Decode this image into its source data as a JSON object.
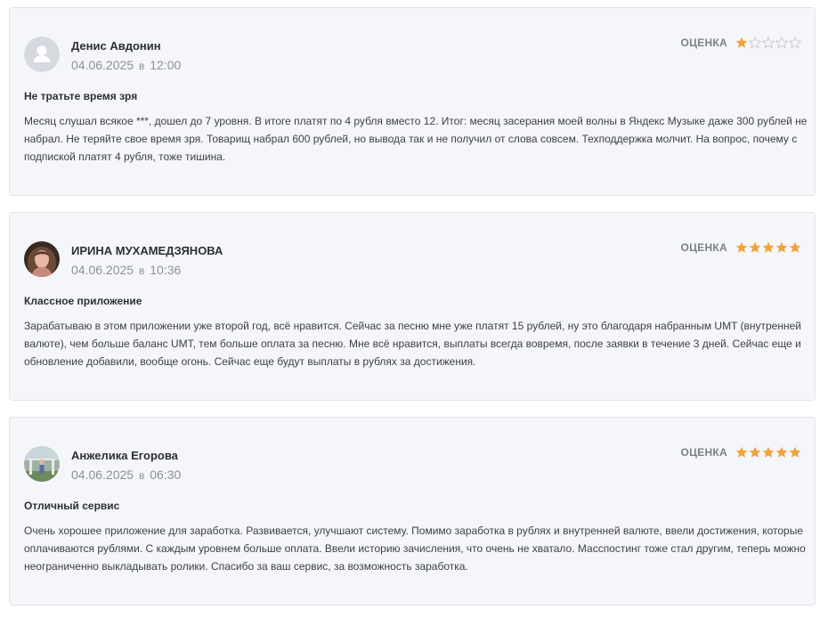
{
  "reviews": [
    {
      "author": "Денис Авдонин",
      "date": "04.06.2025",
      "at": "в",
      "time": "12:00",
      "rating_label": "ОЦЕНКА",
      "rating": 1,
      "rating_max": 5,
      "avatar": "default-user-avatar",
      "title": "Не тратьте время зря",
      "text": "Месяц слушал всякое ***, дошел до 7 уровня. В итоге платят по 4 рубля вместо 12. Итог: месяц засерания моей волны в Яндекс Музыке даже 300 рублей не набрал. Не теряйте свое время зря. Товарищ набрал 600 рублей, но вывода так и не получил от слова совсем. Техподдержка молчит. На вопрос, почему с подпиской платят 4 рубля, тоже тишина."
    },
    {
      "author": "ИРИНА МУХАМЕДЗЯНОВА",
      "date": "04.06.2025",
      "at": "в",
      "time": "10:36",
      "rating_label": "ОЦЕНКА",
      "rating": 5,
      "rating_max": 5,
      "avatar": "user-photo-avatar",
      "title": "Классное приложение",
      "text": "Зарабатываю в этом приложении уже второй год, всё нравится. Сейчас за песню мне уже платят 15 рублей, ну это благодаря набранным UMT (внутренней валюте), чем больше баланс UMT, тем больше оплата за песню. Мне всё нравится, выплаты всегда вовремя, после заявки в течение 3 дней. Сейчас еще и обновление добавили, вообще огонь. Сейчас еще будут выплаты в рублях за достижения."
    },
    {
      "author": "Анжелика Егорова",
      "date": "04.06.2025",
      "at": "в",
      "time": "06:30",
      "rating_label": "ОЦЕНКА",
      "rating": 5,
      "rating_max": 5,
      "avatar": "user-photo-avatar",
      "title": "Отличный сервис",
      "text": "Очень хорошее приложение для заработка. Развивается, улучшают систему. Помимо заработка в рублях и внутренней валюте, ввели достижения, которые оплачиваются рублями. С каждым уровнем больше оплата. Ввели историю зачисления, что очень не хватало. Масспостинг тоже стал другим, теперь можно неограниченно выкладывать ролики. Спасибо за ваш сервис, за возможность заработка."
    }
  ],
  "colors": {
    "card_background": "#f5f6f9",
    "card_border": "#e1e3e8",
    "star_filled": "#f2a33a",
    "star_empty": "#c8c8c8",
    "date_text": "#8b9098"
  }
}
